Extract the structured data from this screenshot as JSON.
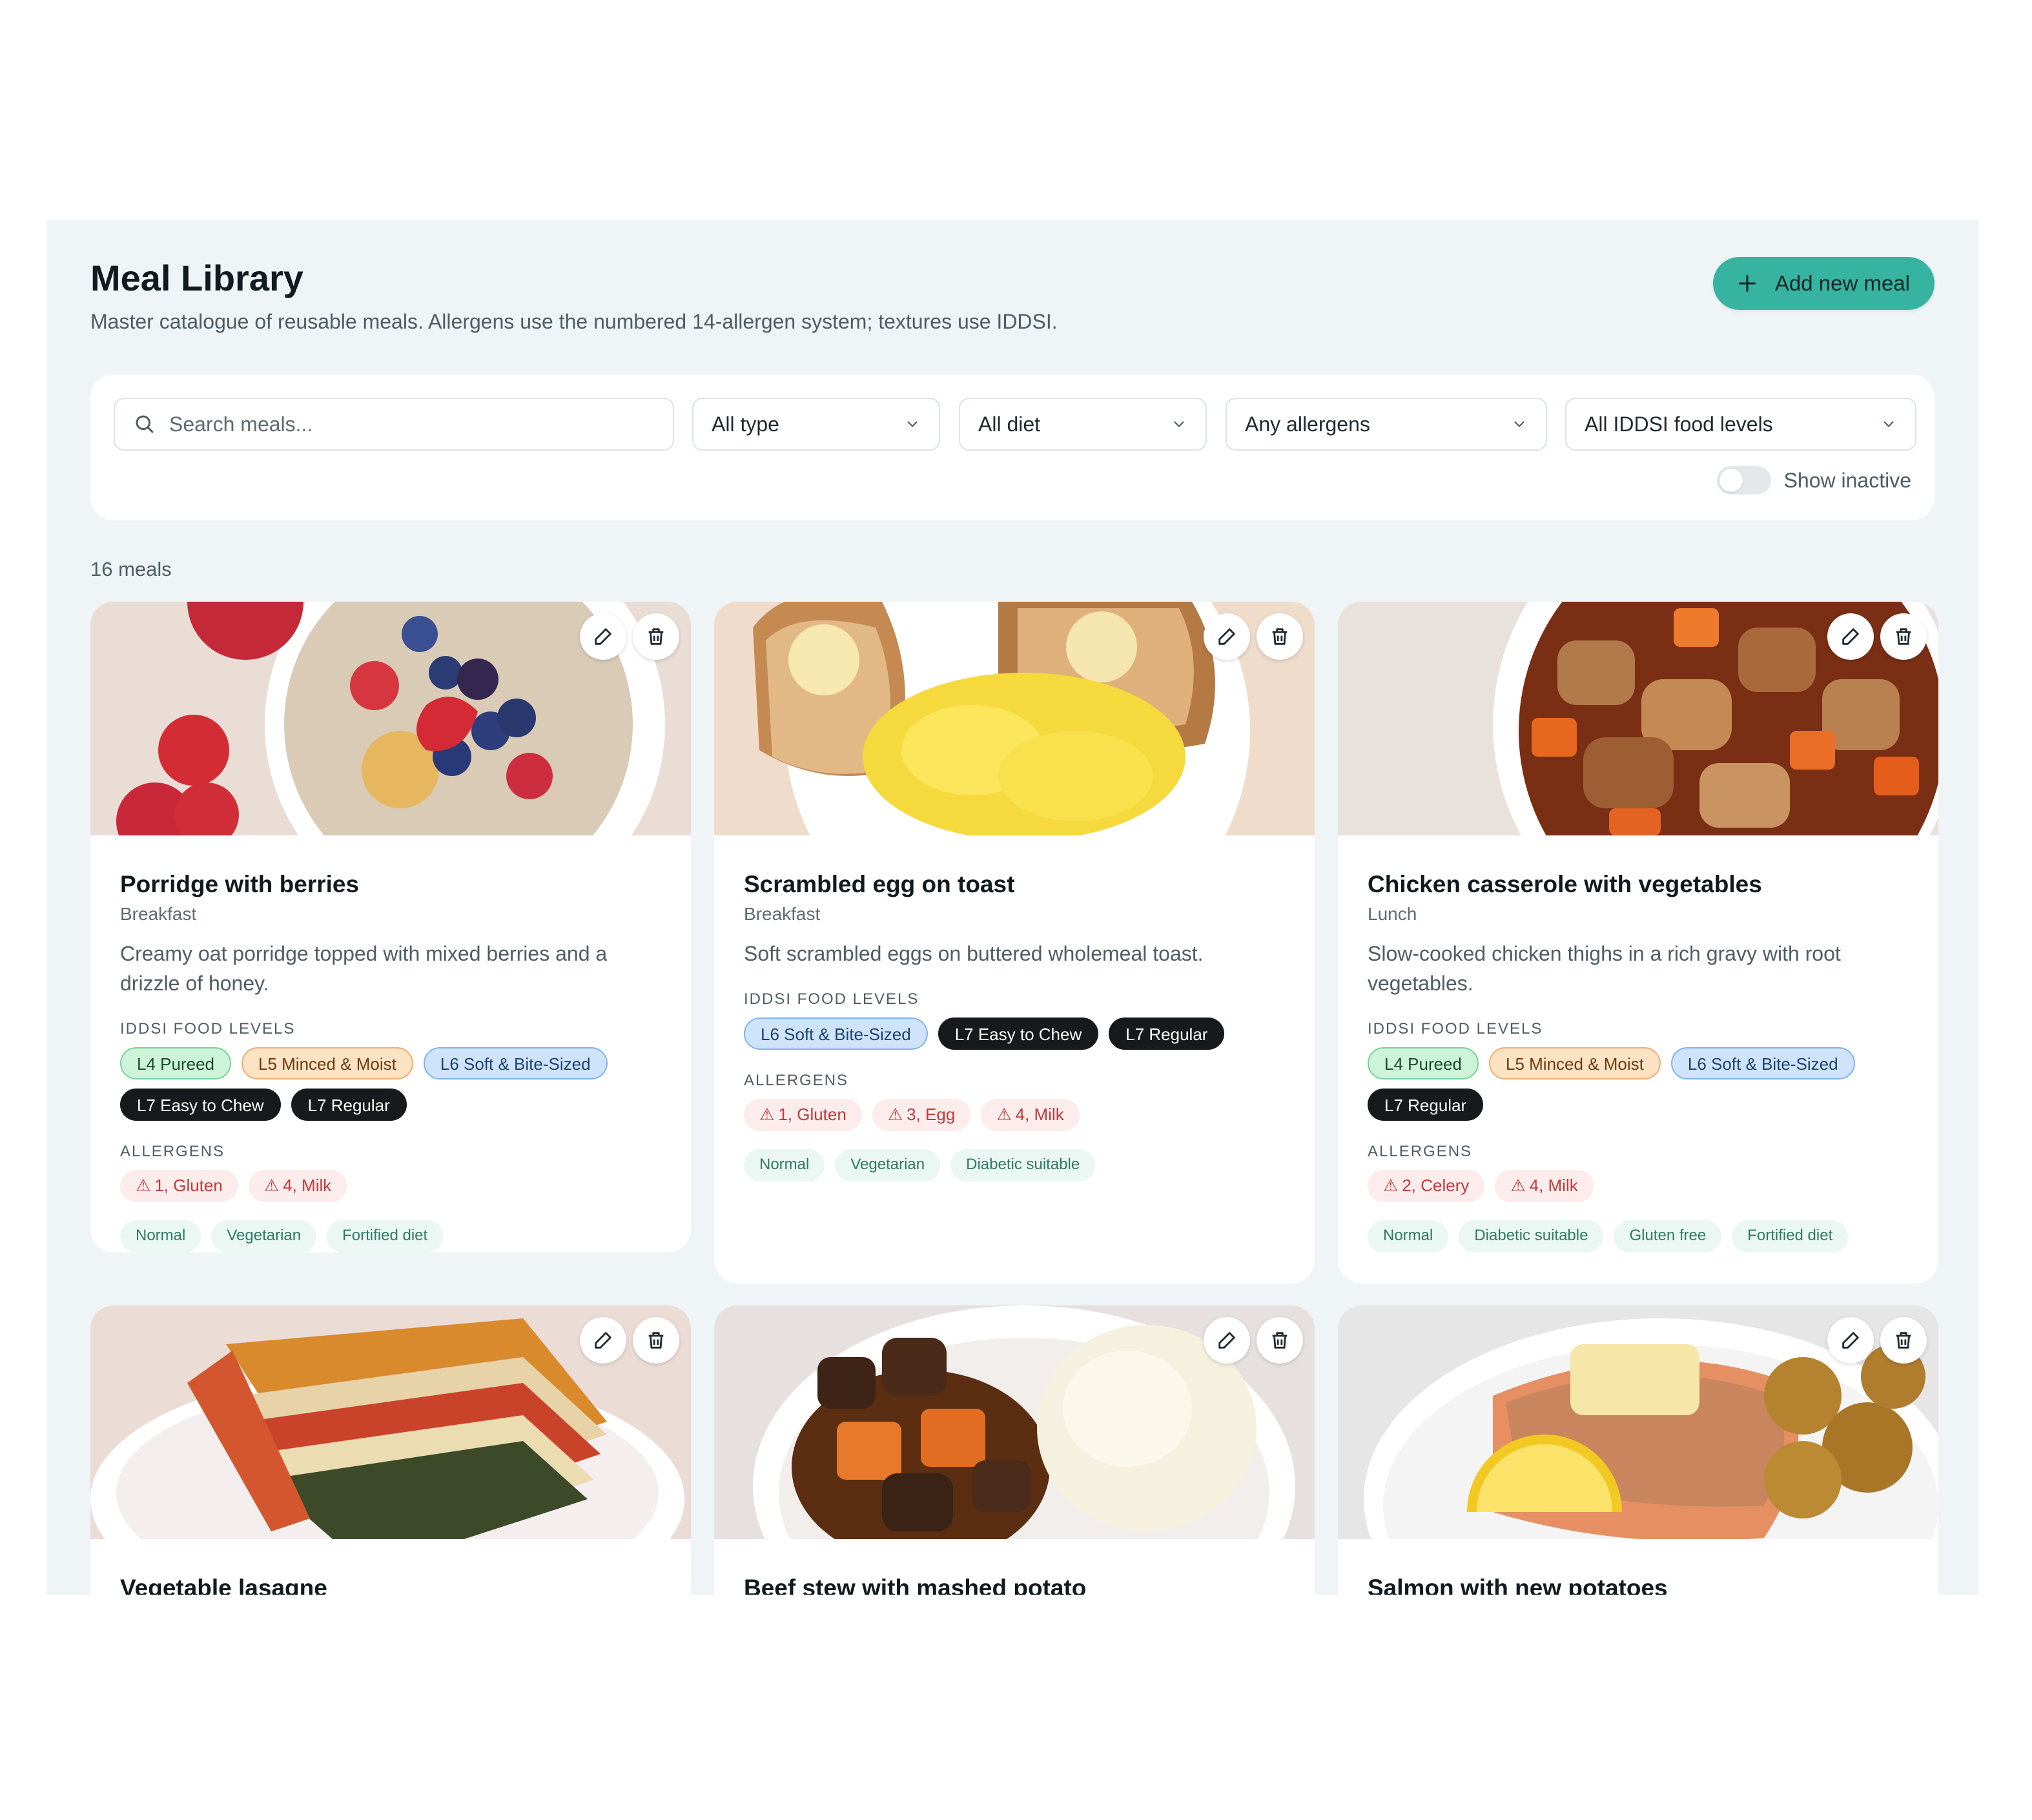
{
  "header": {
    "title": "Meal Library",
    "subtitle": "Master catalogue of reusable meals. Allergens use the numbered 14-allergen system; textures use IDDSI.",
    "add_button_label": "Add new meal",
    "add_icon": "plus-icon",
    "accent_color": "#36b3a1"
  },
  "filters": {
    "search_placeholder": "Search meals...",
    "type": "All type",
    "diet": "All diet",
    "allergens": "Any allergens",
    "iddsi": "All IDDSI food levels",
    "show_inactive_label": "Show inactive",
    "show_inactive": false
  },
  "results": {
    "count_label": "16 meals"
  },
  "labels": {
    "iddsi": "IDDSI FOOD LEVELS",
    "allergens": "ALLERGENS"
  },
  "meals": [
    {
      "name": "Porridge with berries",
      "type": "Breakfast",
      "description": "Creamy oat porridge topped with mixed berries and a drizzle of honey.",
      "levels": [
        "L4 Pureed",
        "L5 Minced & Moist",
        "L6 Soft & Bite-Sized",
        "L7 Easy to Chew",
        "L7 Regular"
      ],
      "allergens": [
        "1, Gluten",
        "4, Milk"
      ],
      "diets": [
        "Normal",
        "Vegetarian",
        "Fortified diet"
      ]
    },
    {
      "name": "Scrambled egg on toast",
      "type": "Breakfast",
      "description": "Soft scrambled eggs on buttered wholemeal toast.",
      "levels": [
        "L6 Soft & Bite-Sized",
        "L7 Easy to Chew",
        "L7 Regular"
      ],
      "allergens": [
        "1, Gluten",
        "3, Egg",
        "4, Milk"
      ],
      "diets": [
        "Normal",
        "Vegetarian",
        "Diabetic suitable"
      ]
    },
    {
      "name": "Chicken casserole with vegetables",
      "type": "Lunch",
      "description": "Slow-cooked chicken thighs in a rich gravy with root vegetables.",
      "levels": [
        "L4 Pureed",
        "L5 Minced & Moist",
        "L6 Soft & Bite-Sized",
        "L7 Regular"
      ],
      "allergens": [
        "2, Celery",
        "4, Milk"
      ],
      "diets": [
        "Normal",
        "Diabetic suitable",
        "Gluten free",
        "Fortified diet"
      ]
    },
    {
      "name": "Vegetable lasagne"
    },
    {
      "name": "Beef stew with mashed potato"
    },
    {
      "name": "Salmon with new potatoes"
    }
  ]
}
